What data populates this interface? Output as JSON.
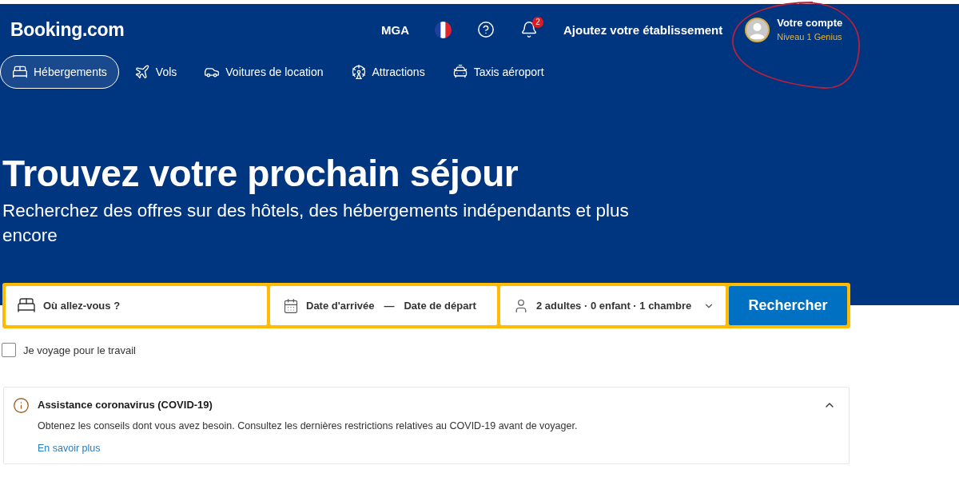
{
  "header": {
    "logo": "Booking.com",
    "currency": "MGA",
    "notification_count": "2",
    "list_property": "Ajoutez votre établissement",
    "account": {
      "name": "Votre compte",
      "level": "Niveau 1 Genius"
    }
  },
  "nav_tabs": [
    {
      "kind": "stays",
      "label": "Hébergements",
      "selected": true
    },
    {
      "kind": "flights",
      "label": "Vols",
      "selected": false
    },
    {
      "kind": "cars",
      "label": "Voitures de location",
      "selected": false
    },
    {
      "kind": "attractions",
      "label": "Attractions",
      "selected": false
    },
    {
      "kind": "taxis",
      "label": "Taxis aéroport",
      "selected": false
    }
  ],
  "hero": {
    "title": "Trouvez votre prochain séjour",
    "subtitle": "Recherchez des offres sur des hôtels, des hébergements indépendants et plus encore"
  },
  "search": {
    "destination": {
      "placeholder": "Où allez-vous ?"
    },
    "dates": {
      "checkin": "Date d'arrivée",
      "separator": "—",
      "checkout": "Date de départ"
    },
    "guests": "2 adultes · 0 enfant · 1 chambre",
    "button": "Rechercher"
  },
  "business_trip": {
    "label": "Je voyage pour le travail",
    "checked": false
  },
  "notice": {
    "title": "Assistance coronavirus (COVID-19)",
    "text": "Obtenez les conseils dont vous avez besoin. Consultez les dernières restrictions relatives au COVID-19 avant de voyager.",
    "link": "En savoir plus",
    "expanded": true
  }
}
